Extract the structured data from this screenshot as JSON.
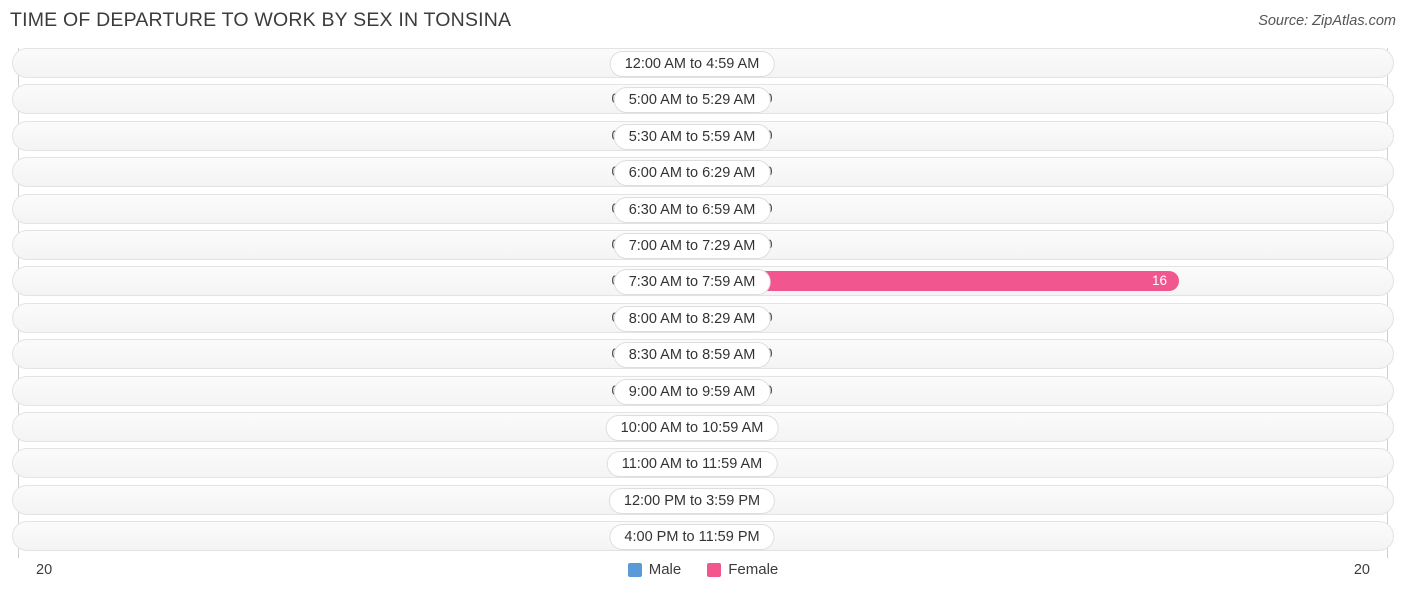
{
  "header": {
    "title": "TIME OF DEPARTURE TO WORK BY SEX IN TONSINA",
    "source": "Source: ZipAtlas.com"
  },
  "axis": {
    "left_label": "20",
    "right_label": "20"
  },
  "legend": {
    "items": [
      {
        "label": "Male",
        "color": "#5b9bd5"
      },
      {
        "label": "Female",
        "color": "#f2568e"
      }
    ]
  },
  "colors": {
    "male_bar": "#aecbec",
    "female_bar": "#f9afc4",
    "female_bar_highlight": "#f2568e",
    "male_legend": "#5b9bd5",
    "female_legend": "#f2568e",
    "row_background": "#f6f6f6",
    "row_border": "#e3e3e3",
    "gridline": "#cfcfcf"
  },
  "chart_data": {
    "type": "bar",
    "title": "TIME OF DEPARTURE TO WORK BY SEX IN TONSINA",
    "orientation": "horizontal-diverging",
    "xlabel": "",
    "ylabel": "",
    "xlim": [
      20,
      20
    ],
    "grid": true,
    "legend_position": "bottom-center",
    "categories": [
      "12:00 AM to 4:59 AM",
      "5:00 AM to 5:29 AM",
      "5:30 AM to 5:59 AM",
      "6:00 AM to 6:29 AM",
      "6:30 AM to 6:59 AM",
      "7:00 AM to 7:29 AM",
      "7:30 AM to 7:59 AM",
      "8:00 AM to 8:29 AM",
      "8:30 AM to 8:59 AM",
      "9:00 AM to 9:59 AM",
      "10:00 AM to 10:59 AM",
      "11:00 AM to 11:59 AM",
      "12:00 PM to 3:59 PM",
      "4:00 PM to 11:59 PM"
    ],
    "series": [
      {
        "name": "Male",
        "values": [
          0,
          0,
          0,
          0,
          0,
          0,
          0,
          0,
          0,
          0,
          0,
          0,
          0,
          0
        ]
      },
      {
        "name": "Female",
        "values": [
          0,
          0,
          0,
          0,
          0,
          0,
          16,
          0,
          0,
          0,
          0,
          0,
          0,
          0
        ]
      }
    ]
  },
  "rows": [
    {
      "label": "12:00 AM to 4:59 AM",
      "male": "0",
      "female": "0",
      "male_w": 66,
      "female_w": 66,
      "highlight": false,
      "inside": false
    },
    {
      "label": "5:00 AM to 5:29 AM",
      "male": "0",
      "female": "0",
      "male_w": 66,
      "female_w": 66,
      "highlight": false,
      "inside": false
    },
    {
      "label": "5:30 AM to 5:59 AM",
      "male": "0",
      "female": "0",
      "male_w": 66,
      "female_w": 66,
      "highlight": false,
      "inside": false
    },
    {
      "label": "6:00 AM to 6:29 AM",
      "male": "0",
      "female": "0",
      "male_w": 66,
      "female_w": 66,
      "highlight": false,
      "inside": false
    },
    {
      "label": "6:30 AM to 6:59 AM",
      "male": "0",
      "female": "0",
      "male_w": 66,
      "female_w": 66,
      "highlight": false,
      "inside": false
    },
    {
      "label": "7:00 AM to 7:29 AM",
      "male": "0",
      "female": "0",
      "male_w": 66,
      "female_w": 66,
      "highlight": false,
      "inside": false
    },
    {
      "label": "7:30 AM to 7:59 AM",
      "male": "0",
      "female": "16",
      "male_w": 66,
      "female_w": 487,
      "highlight": true,
      "inside": true
    },
    {
      "label": "8:00 AM to 8:29 AM",
      "male": "0",
      "female": "0",
      "male_w": 66,
      "female_w": 66,
      "highlight": false,
      "inside": false
    },
    {
      "label": "8:30 AM to 8:59 AM",
      "male": "0",
      "female": "0",
      "male_w": 66,
      "female_w": 66,
      "highlight": false,
      "inside": false
    },
    {
      "label": "9:00 AM to 9:59 AM",
      "male": "0",
      "female": "0",
      "male_w": 66,
      "female_w": 66,
      "highlight": false,
      "inside": false
    },
    {
      "label": "10:00 AM to 10:59 AM",
      "male": "0",
      "female": "0",
      "male_w": 66,
      "female_w": 66,
      "highlight": false,
      "inside": false
    },
    {
      "label": "11:00 AM to 11:59 AM",
      "male": "0",
      "female": "0",
      "male_w": 66,
      "female_w": 66,
      "highlight": false,
      "inside": false
    },
    {
      "label": "12:00 PM to 3:59 PM",
      "male": "0",
      "female": "0",
      "male_w": 66,
      "female_w": 66,
      "highlight": false,
      "inside": false
    },
    {
      "label": "4:00 PM to 11:59 PM",
      "male": "0",
      "female": "0",
      "male_w": 66,
      "female_w": 66,
      "highlight": false,
      "inside": false
    }
  ]
}
